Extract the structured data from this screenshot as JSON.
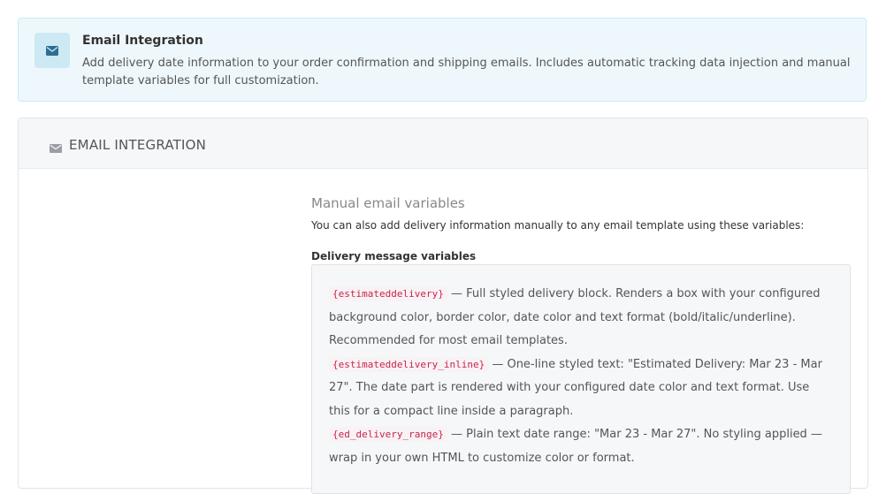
{
  "info": {
    "icon": "envelope-icon",
    "title": "Email Integration",
    "description": "Add delivery date information to your order confirmation and shipping emails. Includes automatic tracking data injection and manual template variables for full customization."
  },
  "panel": {
    "icon": "envelope-icon",
    "title": "EMAIL INTEGRATION"
  },
  "manual": {
    "title": "Manual email variables",
    "subtitle": "You can also add delivery information manually to any email template using these variables:",
    "vars_label": "Delivery message variables",
    "variables": [
      {
        "code": "{estimateddelivery}",
        "text": "— Full styled delivery block. Renders a box with your configured background color, border color, date color and text format (bold/italic/underline). Recommended for most email templates."
      },
      {
        "code": "{estimateddelivery_inline}",
        "text": "— One-line styled text: \"Estimated Delivery: Mar 23 - Mar 27\". The date part is rendered with your configured date color and text format. Use this for a compact line inside a paragraph."
      },
      {
        "code": "{ed_delivery_range}",
        "text": "— Plain text date range: \"Mar 23 - Mar 27\". No styling applied — wrap in your own HTML to customize color or format."
      }
    ]
  },
  "colors": {
    "info_bg": "#eef8fc",
    "info_icon": "#2b6f93",
    "code_text": "#c7254e"
  }
}
